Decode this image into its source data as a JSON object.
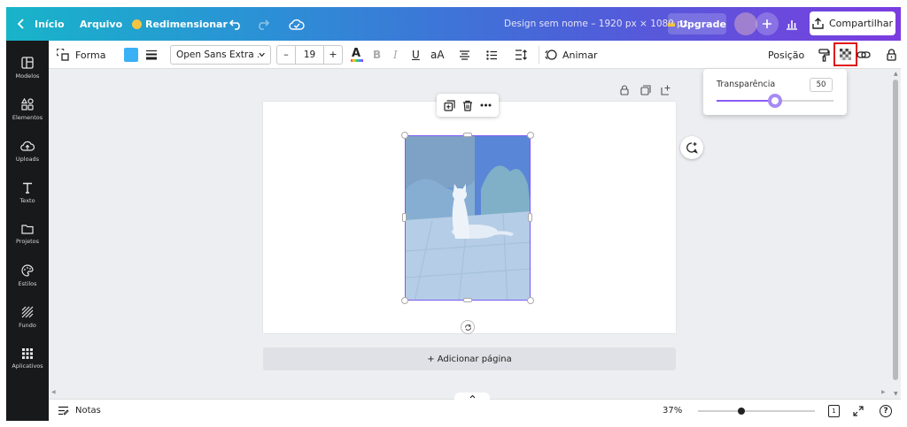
{
  "topbar": {
    "back_label": "Início",
    "file_label": "Arquivo",
    "resize_label": "Redimensionar",
    "design_title": "Design sem nome – 1920 px × 1080 px",
    "upgrade_label": "Upgrade",
    "share_label": "Compartilhar"
  },
  "sidebar": {
    "items": [
      {
        "label": "Modelos",
        "icon": "templates-icon"
      },
      {
        "label": "Elementos",
        "icon": "elements-icon"
      },
      {
        "label": "Uploads",
        "icon": "upload-cloud-icon"
      },
      {
        "label": "Texto",
        "icon": "text-icon"
      },
      {
        "label": "Projetos",
        "icon": "folder-icon"
      },
      {
        "label": "Estilos",
        "icon": "palette-icon"
      },
      {
        "label": "Fundo",
        "icon": "background-icon"
      },
      {
        "label": "Aplicativos",
        "icon": "apps-grid-icon"
      }
    ]
  },
  "toolbar": {
    "shape_label": "Forma",
    "fill_color": "#3ab0f5",
    "font_name": "Open Sans Extra ...",
    "font_size": "19",
    "minus_label": "–",
    "plus_label": "+",
    "bold_label": "B",
    "italic_label": "I",
    "underline_label": "U",
    "case_label": "aA",
    "animate_label": "Animar",
    "position_label": "Posição"
  },
  "transparency": {
    "label": "Transparência",
    "value": "50",
    "level": 0.5
  },
  "canvas": {
    "add_page_label": "+ Adicionar página"
  },
  "bottombar": {
    "notes_label": "Notas",
    "zoom_label": "37%",
    "zoom_level": 0.37,
    "page_count": "1"
  },
  "colors": {
    "accent": "#7d5cf0",
    "highlight_box": "#e01414"
  }
}
